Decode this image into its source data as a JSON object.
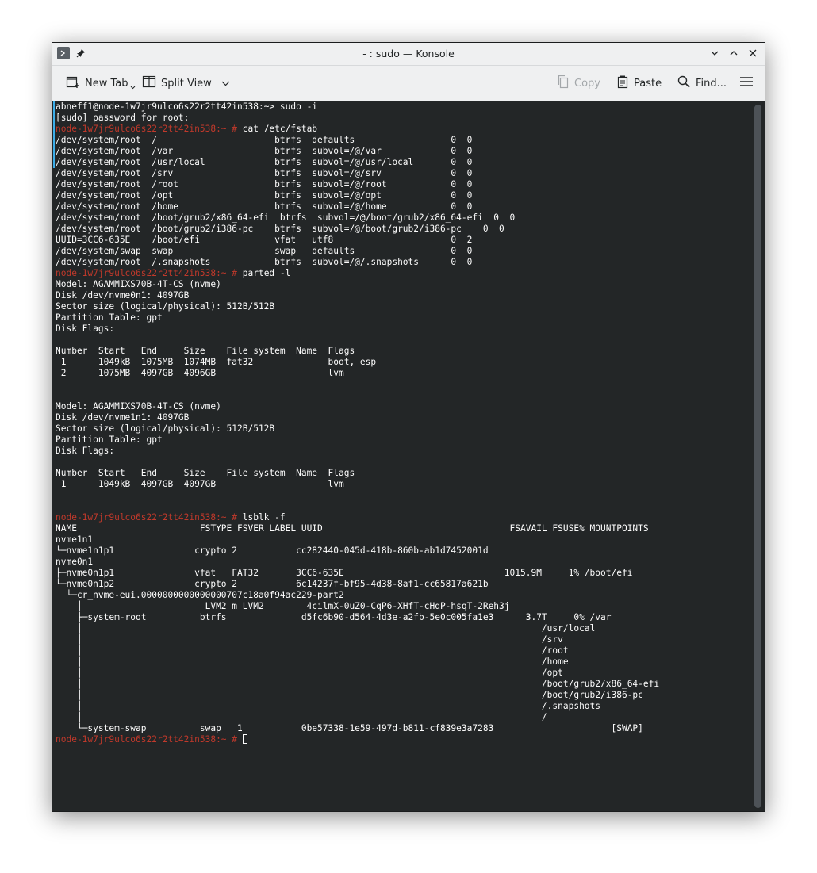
{
  "window": {
    "title": "- : sudo — Konsole"
  },
  "toolbar": {
    "new_tab": "New Tab",
    "split_view": "Split View",
    "copy": "Copy",
    "paste": "Paste",
    "find": "Find..."
  },
  "terminal": {
    "lines": [
      {
        "text": "abneff1@node-1w7jr9ulco6s22r2tt42in538:~> sudo -i"
      },
      {
        "text": "[sudo] password for root:"
      },
      {
        "prompt": "node-1w7jr9ulco6s22r2tt42in538:~ #",
        "text": " cat /etc/fstab"
      },
      {
        "text": "/dev/system/root  /                      btrfs  defaults                  0  0"
      },
      {
        "text": "/dev/system/root  /var                   btrfs  subvol=/@/var             0  0"
      },
      {
        "text": "/dev/system/root  /usr/local             btrfs  subvol=/@/usr/local       0  0"
      },
      {
        "text": "/dev/system/root  /srv                   btrfs  subvol=/@/srv             0  0"
      },
      {
        "text": "/dev/system/root  /root                  btrfs  subvol=/@/root            0  0"
      },
      {
        "text": "/dev/system/root  /opt                   btrfs  subvol=/@/opt             0  0"
      },
      {
        "text": "/dev/system/root  /home                  btrfs  subvol=/@/home            0  0"
      },
      {
        "text": "/dev/system/root  /boot/grub2/x86_64-efi  btrfs  subvol=/@/boot/grub2/x86_64-efi  0  0"
      },
      {
        "text": "/dev/system/root  /boot/grub2/i386-pc    btrfs  subvol=/@/boot/grub2/i386-pc    0  0"
      },
      {
        "text": "UUID=3CC6-635E    /boot/efi              vfat   utf8                      0  2"
      },
      {
        "text": "/dev/system/swap  swap                   swap   defaults                  0  0"
      },
      {
        "text": "/dev/system/root  /.snapshots            btrfs  subvol=/@/.snapshots      0  0"
      },
      {
        "prompt": "node-1w7jr9ulco6s22r2tt42in538:~ #",
        "text": " parted -l"
      },
      {
        "text": "Model: AGAMMIXS70B-4T-CS (nvme)"
      },
      {
        "text": "Disk /dev/nvme0n1: 4097GB"
      },
      {
        "text": "Sector size (logical/physical): 512B/512B"
      },
      {
        "text": "Partition Table: gpt"
      },
      {
        "text": "Disk Flags:"
      },
      {
        "text": ""
      },
      {
        "text": "Number  Start   End     Size    File system  Name  Flags"
      },
      {
        "text": " 1      1049kB  1075MB  1074MB  fat32              boot, esp"
      },
      {
        "text": " 2      1075MB  4097GB  4096GB                     lvm"
      },
      {
        "text": ""
      },
      {
        "text": ""
      },
      {
        "text": "Model: AGAMMIXS70B-4T-CS (nvme)"
      },
      {
        "text": "Disk /dev/nvme1n1: 4097GB"
      },
      {
        "text": "Sector size (logical/physical): 512B/512B"
      },
      {
        "text": "Partition Table: gpt"
      },
      {
        "text": "Disk Flags:"
      },
      {
        "text": ""
      },
      {
        "text": "Number  Start   End     Size    File system  Name  Flags"
      },
      {
        "text": " 1      1049kB  4097GB  4097GB                     lvm"
      },
      {
        "text": ""
      },
      {
        "text": ""
      },
      {
        "prompt": "node-1w7jr9ulco6s22r2tt42in538:~ #",
        "text": " lsblk -f"
      },
      {
        "text": "NAME                       FSTYPE FSVER LABEL UUID                                   FSAVAIL FSUSE% MOUNTPOINTS"
      },
      {
        "text": "nvme1n1"
      },
      {
        "text": "└─nvme1n1p1               crypto 2           cc282440-045d-418b-860b-ab1d7452001d"
      },
      {
        "text": "nvme0n1"
      },
      {
        "text": "├─nvme0n1p1               vfat   FAT32       3CC6-635E                              1015.9M     1% /boot/efi"
      },
      {
        "text": "└─nvme0n1p2               crypto 2           6c14237f-bf95-4d38-8af1-cc65817a621b"
      },
      {
        "text": "  └─cr_nvme-eui.0000000000000000707c18a0f94ac229-part2"
      },
      {
        "text": "    │                       LVM2_m LVM2        4cilmX-0uZ0-CqP6-XHfT-cHqP-hsqT-2Reh3j"
      },
      {
        "text": "    ├─system-root          btrfs              d5fc6b90-d564-4d3e-a2fb-5e0c005fa1e3      3.7T     0% /var"
      },
      {
        "text": "    │                                                                                      /usr/local"
      },
      {
        "text": "    │                                                                                      /srv"
      },
      {
        "text": "    │                                                                                      /root"
      },
      {
        "text": "    │                                                                                      /home"
      },
      {
        "text": "    │                                                                                      /opt"
      },
      {
        "text": "    │                                                                                      /boot/grub2/x86_64-efi"
      },
      {
        "text": "    │                                                                                      /boot/grub2/i386-pc"
      },
      {
        "text": "    │                                                                                      /.snapshots"
      },
      {
        "text": "    │                                                                                      /"
      },
      {
        "text": "    └─system-swap          swap   1           0be57338-1e59-497d-b811-cf839e3a7283                      [SWAP]"
      },
      {
        "prompt": "node-1w7jr9ulco6s22r2tt42in538:~ #",
        "text": " ",
        "cursor": true
      }
    ]
  },
  "colors": {
    "prompt": "#c0392b",
    "terminal_bg": "#232627",
    "terminal_fg": "#fcfcfc",
    "chrome": "#eff0f1"
  }
}
